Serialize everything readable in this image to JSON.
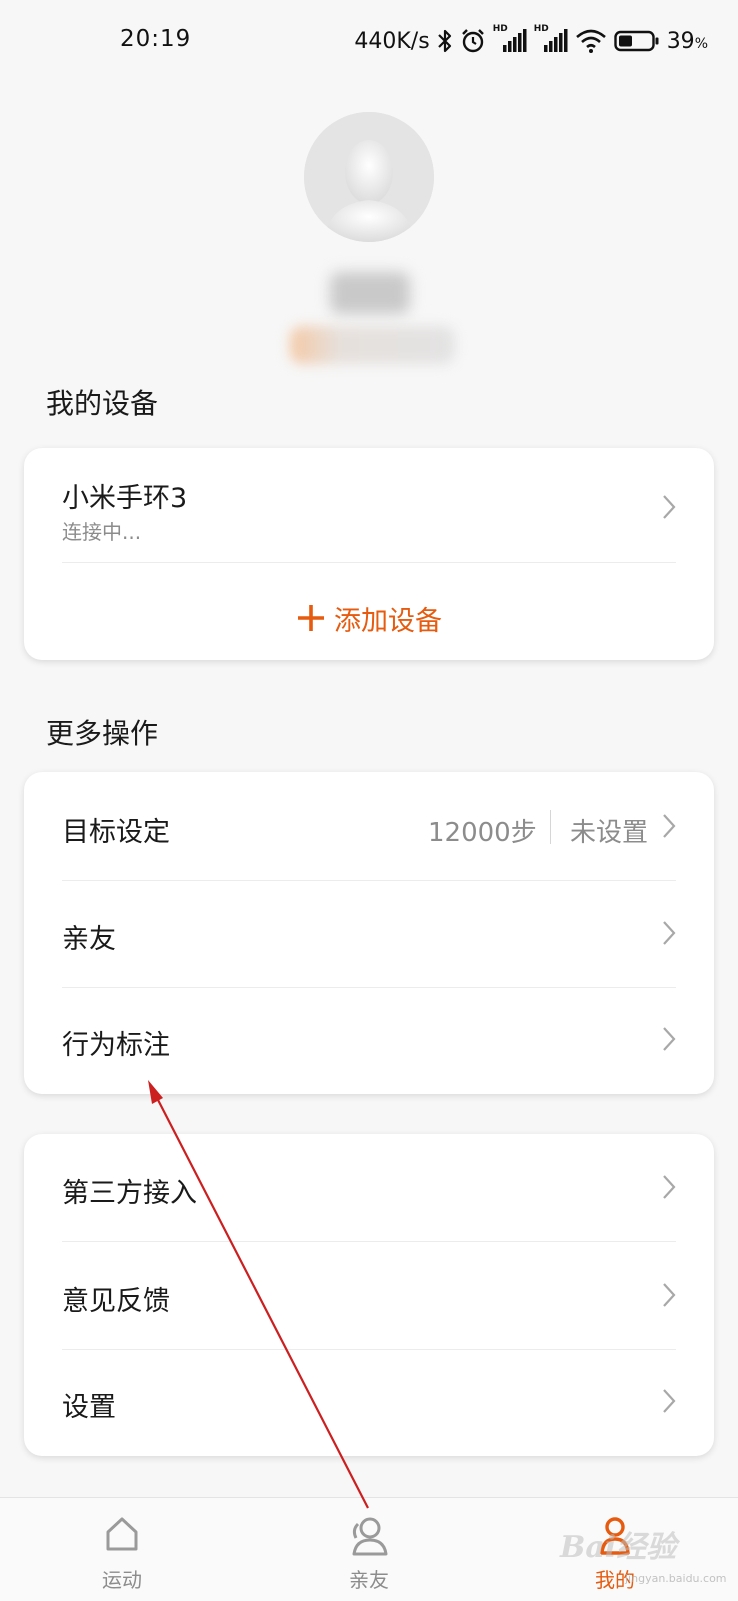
{
  "status_bar": {
    "time": "20:19",
    "network_speed": "440K/s",
    "signal_1_label": "HD",
    "signal_2_label": "HD",
    "battery_percent": "39",
    "battery_unit": "%"
  },
  "profile": {
    "avatar_icon": "default-user-avatar"
  },
  "my_devices": {
    "title": "我的设备",
    "device_name": "小米手环3",
    "device_status": "连接中...",
    "add_device_label": "添加设备"
  },
  "more_actions": {
    "title": "更多操作",
    "goal_label": "目标设定",
    "goal_steps": "12000步",
    "goal_status": "未设置",
    "friends_label": "亲友",
    "behavior_label": "行为标注"
  },
  "other_actions": {
    "third_party_label": "第三方接入",
    "feedback_label": "意见反馈",
    "settings_label": "设置"
  },
  "tab_bar": {
    "tabs": [
      {
        "label": "运动",
        "icon": "home-icon",
        "active": false
      },
      {
        "label": "亲友",
        "icon": "friends-icon",
        "active": false
      },
      {
        "label": "我的",
        "icon": "profile-icon",
        "active": true
      }
    ]
  },
  "watermark": {
    "text": "Bai经验",
    "sub": "jingyan.baidu.com"
  },
  "colors": {
    "accent": "#e65b0f",
    "background": "#f7f7f7",
    "card": "#ffffff",
    "annotation_arrow": "#cc1f1f"
  }
}
